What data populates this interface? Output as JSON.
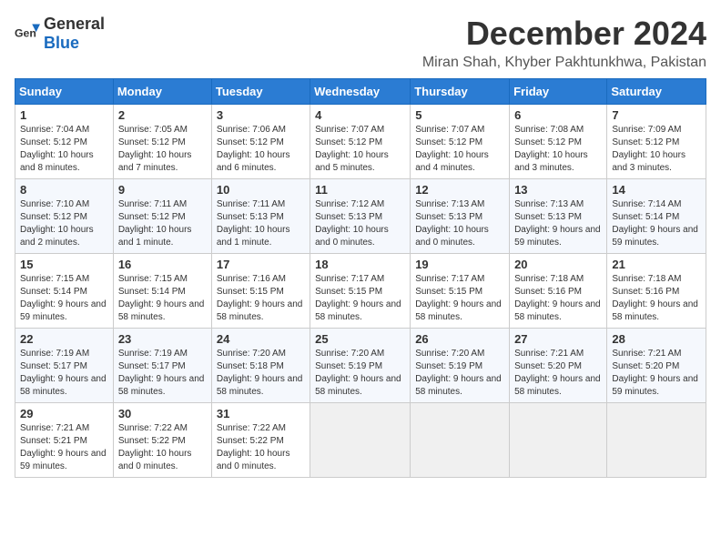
{
  "logo": {
    "general": "General",
    "blue": "Blue"
  },
  "header": {
    "month": "December 2024",
    "location": "Miran Shah, Khyber Pakhtunkhwa, Pakistan"
  },
  "days_of_week": [
    "Sunday",
    "Monday",
    "Tuesday",
    "Wednesday",
    "Thursday",
    "Friday",
    "Saturday"
  ],
  "weeks": [
    [
      {
        "day": "1",
        "sunrise": "7:04 AM",
        "sunset": "5:12 PM",
        "daylight": "10 hours and 8 minutes."
      },
      {
        "day": "2",
        "sunrise": "7:05 AM",
        "sunset": "5:12 PM",
        "daylight": "10 hours and 7 minutes."
      },
      {
        "day": "3",
        "sunrise": "7:06 AM",
        "sunset": "5:12 PM",
        "daylight": "10 hours and 6 minutes."
      },
      {
        "day": "4",
        "sunrise": "7:07 AM",
        "sunset": "5:12 PM",
        "daylight": "10 hours and 5 minutes."
      },
      {
        "day": "5",
        "sunrise": "7:07 AM",
        "sunset": "5:12 PM",
        "daylight": "10 hours and 4 minutes."
      },
      {
        "day": "6",
        "sunrise": "7:08 AM",
        "sunset": "5:12 PM",
        "daylight": "10 hours and 3 minutes."
      },
      {
        "day": "7",
        "sunrise": "7:09 AM",
        "sunset": "5:12 PM",
        "daylight": "10 hours and 3 minutes."
      }
    ],
    [
      {
        "day": "8",
        "sunrise": "7:10 AM",
        "sunset": "5:12 PM",
        "daylight": "10 hours and 2 minutes."
      },
      {
        "day": "9",
        "sunrise": "7:11 AM",
        "sunset": "5:12 PM",
        "daylight": "10 hours and 1 minute."
      },
      {
        "day": "10",
        "sunrise": "7:11 AM",
        "sunset": "5:13 PM",
        "daylight": "10 hours and 1 minute."
      },
      {
        "day": "11",
        "sunrise": "7:12 AM",
        "sunset": "5:13 PM",
        "daylight": "10 hours and 0 minutes."
      },
      {
        "day": "12",
        "sunrise": "7:13 AM",
        "sunset": "5:13 PM",
        "daylight": "10 hours and 0 minutes."
      },
      {
        "day": "13",
        "sunrise": "7:13 AM",
        "sunset": "5:13 PM",
        "daylight": "9 hours and 59 minutes."
      },
      {
        "day": "14",
        "sunrise": "7:14 AM",
        "sunset": "5:14 PM",
        "daylight": "9 hours and 59 minutes."
      }
    ],
    [
      {
        "day": "15",
        "sunrise": "7:15 AM",
        "sunset": "5:14 PM",
        "daylight": "9 hours and 59 minutes."
      },
      {
        "day": "16",
        "sunrise": "7:15 AM",
        "sunset": "5:14 PM",
        "daylight": "9 hours and 58 minutes."
      },
      {
        "day": "17",
        "sunrise": "7:16 AM",
        "sunset": "5:15 PM",
        "daylight": "9 hours and 58 minutes."
      },
      {
        "day": "18",
        "sunrise": "7:17 AM",
        "sunset": "5:15 PM",
        "daylight": "9 hours and 58 minutes."
      },
      {
        "day": "19",
        "sunrise": "7:17 AM",
        "sunset": "5:15 PM",
        "daylight": "9 hours and 58 minutes."
      },
      {
        "day": "20",
        "sunrise": "7:18 AM",
        "sunset": "5:16 PM",
        "daylight": "9 hours and 58 minutes."
      },
      {
        "day": "21",
        "sunrise": "7:18 AM",
        "sunset": "5:16 PM",
        "daylight": "9 hours and 58 minutes."
      }
    ],
    [
      {
        "day": "22",
        "sunrise": "7:19 AM",
        "sunset": "5:17 PM",
        "daylight": "9 hours and 58 minutes."
      },
      {
        "day": "23",
        "sunrise": "7:19 AM",
        "sunset": "5:17 PM",
        "daylight": "9 hours and 58 minutes."
      },
      {
        "day": "24",
        "sunrise": "7:20 AM",
        "sunset": "5:18 PM",
        "daylight": "9 hours and 58 minutes."
      },
      {
        "day": "25",
        "sunrise": "7:20 AM",
        "sunset": "5:19 PM",
        "daylight": "9 hours and 58 minutes."
      },
      {
        "day": "26",
        "sunrise": "7:20 AM",
        "sunset": "5:19 PM",
        "daylight": "9 hours and 58 minutes."
      },
      {
        "day": "27",
        "sunrise": "7:21 AM",
        "sunset": "5:20 PM",
        "daylight": "9 hours and 58 minutes."
      },
      {
        "day": "28",
        "sunrise": "7:21 AM",
        "sunset": "5:20 PM",
        "daylight": "9 hours and 59 minutes."
      }
    ],
    [
      {
        "day": "29",
        "sunrise": "7:21 AM",
        "sunset": "5:21 PM",
        "daylight": "9 hours and 59 minutes."
      },
      {
        "day": "30",
        "sunrise": "7:22 AM",
        "sunset": "5:22 PM",
        "daylight": "10 hours and 0 minutes."
      },
      {
        "day": "31",
        "sunrise": "7:22 AM",
        "sunset": "5:22 PM",
        "daylight": "10 hours and 0 minutes."
      },
      null,
      null,
      null,
      null
    ]
  ],
  "labels": {
    "sunrise": "Sunrise:",
    "sunset": "Sunset:",
    "daylight": "Daylight:"
  }
}
